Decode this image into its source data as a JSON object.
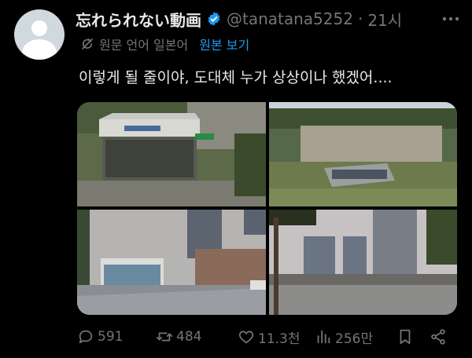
{
  "tweet": {
    "display_name": "忘れられない動画",
    "handle": "@tanatana5252",
    "separator": "·",
    "time": "21시",
    "translated_from": "원문 언어 일본어",
    "show_original": "원본 보기",
    "text": "이렇게 될 줄이야, 도대체 누가 상상이나 했겠어....",
    "verified": true
  },
  "actions": {
    "replies": "591",
    "retweets": "484",
    "likes": "11.3천",
    "views": "256만"
  },
  "colors": {
    "accent": "#1d9bf0",
    "muted": "#71767b",
    "text": "#e7e9ea",
    "background": "#000000"
  },
  "icons": {
    "more": "more-icon",
    "translate": "translate-icon",
    "reply": "reply-icon",
    "retweet": "retweet-icon",
    "like": "heart-icon",
    "views": "views-icon",
    "bookmark": "bookmark-icon",
    "share": "share-icon"
  }
}
